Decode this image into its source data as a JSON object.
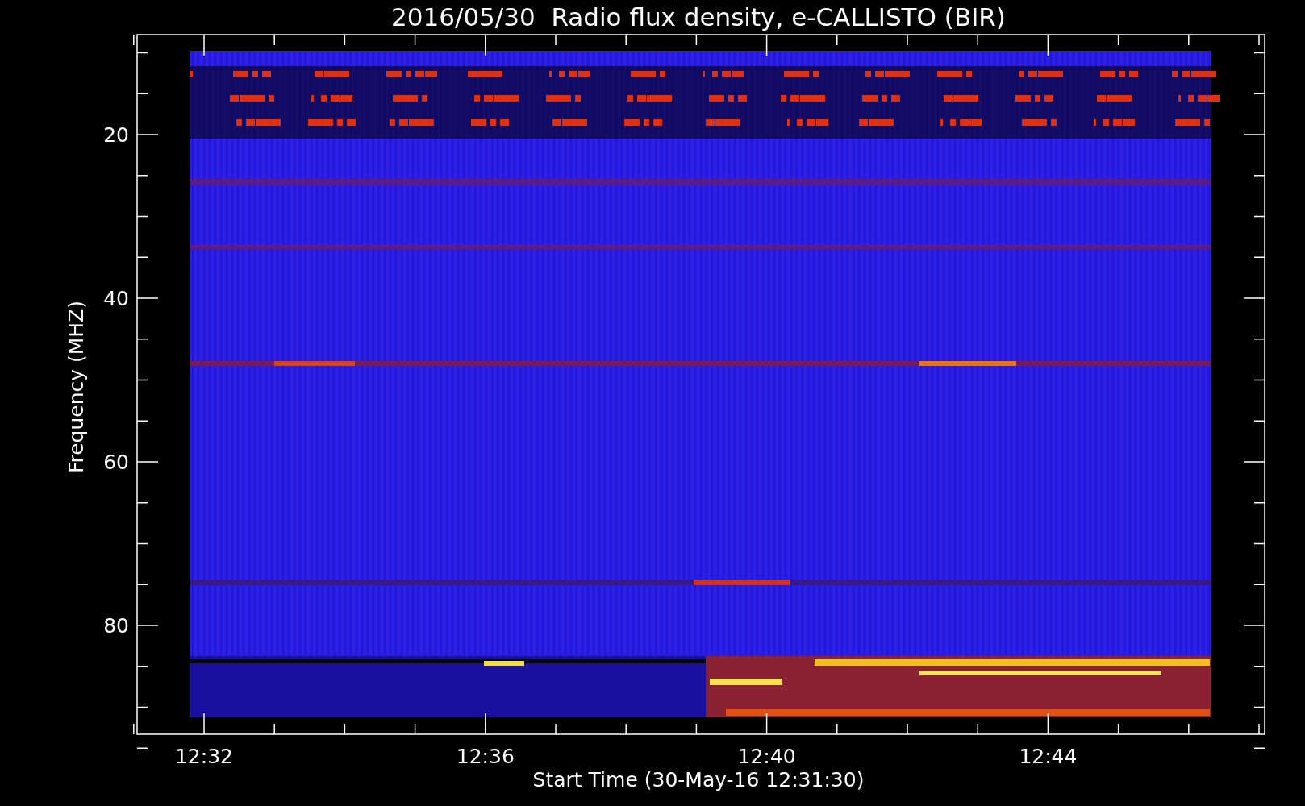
{
  "title": "2016/05/30  Radio flux density, e-CALLISTO (BIR)",
  "y_axis": {
    "label": "Frequency (MHZ)",
    "ticks": [
      "20",
      "40",
      "60",
      "80"
    ]
  },
  "x_axis": {
    "label": "Start Time (30-May-16 12:31:30)",
    "ticks": [
      "12:32",
      "12:36",
      "12:40",
      "12:44"
    ]
  }
}
